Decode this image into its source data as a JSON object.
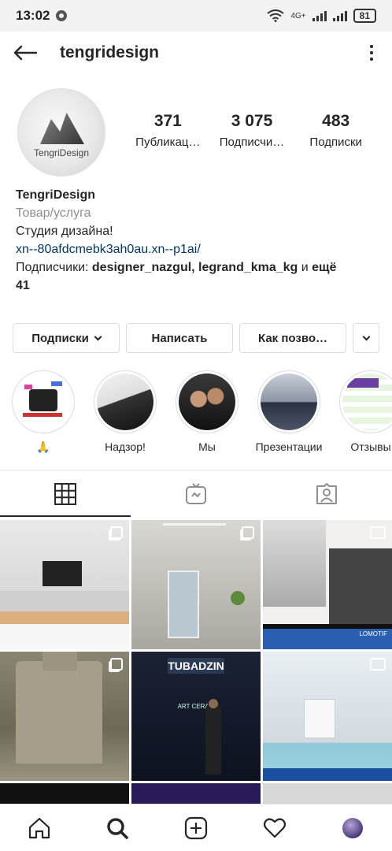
{
  "status_bar": {
    "time": "13:02",
    "network": "4G+",
    "battery": "81"
  },
  "header": {
    "username": "tengridesign"
  },
  "profile": {
    "avatar_text": "TengriDesign",
    "stats": [
      {
        "value": "371",
        "label": "Публикац…"
      },
      {
        "value": "3 075",
        "label": "Подписчи…"
      },
      {
        "value": "483",
        "label": "Подписки"
      }
    ],
    "name": "TengriDesign",
    "category": "Товар/услуга",
    "bio": "Студия дизайна!",
    "link": "xn--80afdcmebk3ah0au.xn--p1ai/",
    "followers_prefix": "Подписчики: ",
    "followers_names": "designer_nazgul, legrand_kma_kg",
    "followers_and": " и ",
    "followers_more": "ещё",
    "followers_count": "41"
  },
  "buttons": {
    "following": "Подписки",
    "message": "Написать",
    "contact": "Как позво…"
  },
  "highlights": [
    {
      "label": "🙏"
    },
    {
      "label": "Надзор!"
    },
    {
      "label": "Мы"
    },
    {
      "label": "Презентации"
    },
    {
      "label": "Отзывы"
    }
  ],
  "grid_text": {
    "brand_sign": "TUBADZIN",
    "brand_sub": "ART CERAM",
    "screen_label": "LOMOTIF"
  },
  "colors": {
    "link": "#00376b",
    "secondary_text": "#8e8e8e",
    "border": "#dbdbdb",
    "text": "#262626"
  }
}
